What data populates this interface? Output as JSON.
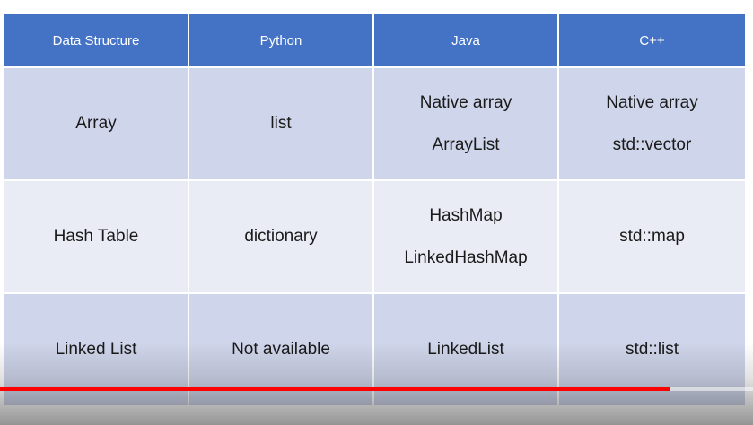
{
  "table": {
    "headers": [
      "Data Structure",
      "Python",
      "Java",
      "C++"
    ],
    "rows": [
      {
        "structure": "Array",
        "python": "list",
        "java": [
          "Native array",
          "ArrayList"
        ],
        "cpp": [
          "Native array",
          "std::vector"
        ]
      },
      {
        "structure": "Hash Table",
        "python": "dictionary",
        "java": [
          "HashMap",
          "LinkedHashMap"
        ],
        "cpp": "std::map"
      },
      {
        "structure": "Linked List",
        "python": "Not available",
        "java": "LinkedList",
        "cpp": "std::list"
      }
    ]
  },
  "player": {
    "progress_fraction": 0.89,
    "progress_color": "#ff0000"
  },
  "colors": {
    "header_bg": "#4472c4",
    "row_dark": "#cfd5ea",
    "row_light": "#e9ebf5"
  }
}
